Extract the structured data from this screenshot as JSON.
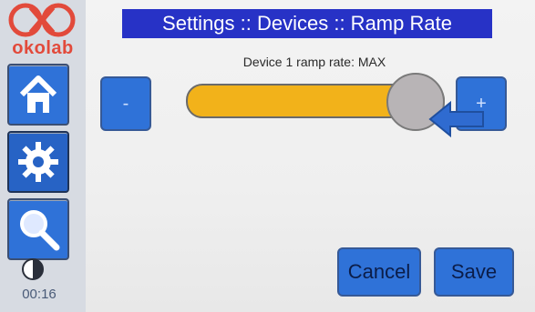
{
  "brand": {
    "logo_text": "okolab"
  },
  "sidebar": {
    "items": [
      {
        "name": "home",
        "icon": "home-icon"
      },
      {
        "name": "settings",
        "icon": "gear-icon"
      },
      {
        "name": "search",
        "icon": "search-icon"
      }
    ],
    "contrast_icon": "contrast-icon",
    "clock": "00:16"
  },
  "header": {
    "title": "Settings :: Devices :: Ramp Rate"
  },
  "main": {
    "subtitle": "Device 1 ramp rate: MAX",
    "minus_label": "-",
    "plus_label": "+",
    "slider": {
      "level_fraction": 1.0
    }
  },
  "actions": {
    "cancel_label": "Cancel",
    "save_label": "Save"
  },
  "colors": {
    "accent_blue": "#2f72d8",
    "header_blue": "#2732c6",
    "slider_fill": "#f2b21a",
    "brand_red": "#e24a3b"
  }
}
